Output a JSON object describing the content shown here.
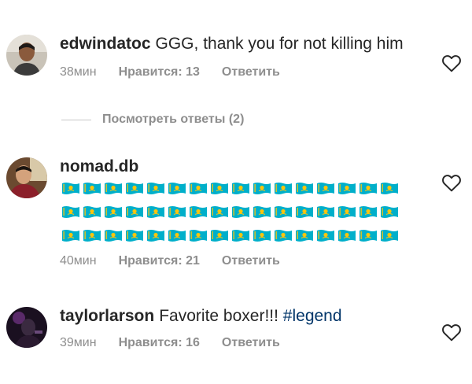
{
  "comments": [
    {
      "username": "edwindatoc",
      "text": "GGG, thank you for not killing him",
      "time": "38мин",
      "likes": "Нравится: 13",
      "reply": "Ответить",
      "avatar_icon": "user-avatar",
      "like_icon": "heart-outline-icon"
    },
    {
      "username": "nomad.db",
      "text": "",
      "emoji_name": "kazakhstan-flag",
      "emoji_rows": 3,
      "emoji_per_row": 16,
      "time": "40мин",
      "likes": "Нравится: 21",
      "reply": "Ответить",
      "avatar_icon": "user-avatar",
      "like_icon": "heart-outline-icon"
    },
    {
      "username": "taylorlarson",
      "text": "Favorite boxer!!!",
      "hashtag": "#legend",
      "time": "39мин",
      "likes": "Нравится: 16",
      "reply": "Ответить",
      "avatar_icon": "user-avatar",
      "like_icon": "heart-outline-icon"
    }
  ],
  "view_replies": "Посмотреть ответы (2)",
  "colors": {
    "text": "#262626",
    "meta": "#8e8e8e",
    "hashtag": "#003569",
    "flag_blue": "#00afca",
    "flag_gold": "#fec50c"
  }
}
